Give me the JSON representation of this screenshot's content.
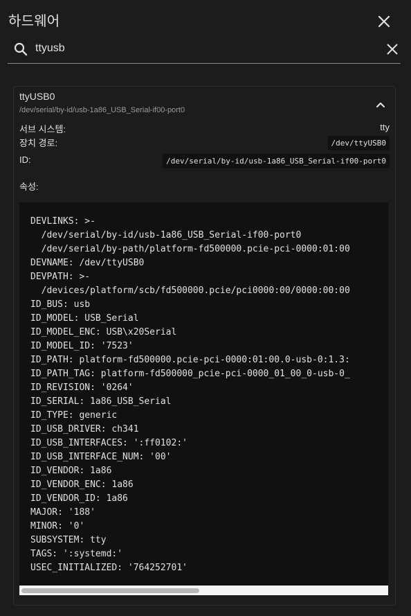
{
  "dialog": {
    "title": "하드웨어",
    "close_icon": "close-icon"
  },
  "search": {
    "value": "ttyusb",
    "icon": "search-icon",
    "clear_icon": "clear-icon"
  },
  "device": {
    "name": "ttyUSB0",
    "path": "/dev/serial/by-id/usb-1a86_USB_Serial-if00-port0",
    "collapse_icon": "chevron-up-icon",
    "subsystem_label": "서브 시스템:",
    "subsystem_value": "tty",
    "device_path_label": "장치 경로:",
    "device_path_value": "/dev/ttyUSB0",
    "id_label": "ID:",
    "id_value": "/dev/serial/by-id/usb-1a86_USB_Serial-if00-port0",
    "attributes_label": "속성:",
    "attributes": [
      "DEVLINKS: >-",
      "  /dev/serial/by-id/usb-1a86_USB_Serial-if00-port0",
      "  /dev/serial/by-path/platform-fd500000.pcie-pci-0000:01:00",
      "DEVNAME: /dev/ttyUSB0",
      "DEVPATH: >-",
      "  /devices/platform/scb/fd500000.pcie/pci0000:00/0000:00:00",
      "ID_BUS: usb",
      "ID_MODEL: USB_Serial",
      "ID_MODEL_ENC: USB\\x20Serial",
      "ID_MODEL_ID: '7523'",
      "ID_PATH: platform-fd500000.pcie-pci-0000:01:00.0-usb-0:1.3:",
      "ID_PATH_TAG: platform-fd500000_pcie-pci-0000_01_00_0-usb-0_",
      "ID_REVISION: '0264'",
      "ID_SERIAL: 1a86_USB_Serial",
      "ID_TYPE: generic",
      "ID_USB_DRIVER: ch341",
      "ID_USB_INTERFACES: ':ff0102:'",
      "ID_USB_INTERFACE_NUM: '00'",
      "ID_VENDOR: 1a86",
      "ID_VENDOR_ENC: 1a86",
      "ID_VENDOR_ID: 1a86",
      "MAJOR: '188'",
      "MINOR: '0'",
      "SUBSYSTEM: tty",
      "TAGS: ':systemd:'",
      "USEC_INITIALIZED: '764252701'"
    ]
  },
  "colors": {
    "background": "#1c1c1c",
    "code_background": "#111111",
    "text": "#e1e1e1",
    "secondary_text": "#9b9b9b"
  }
}
